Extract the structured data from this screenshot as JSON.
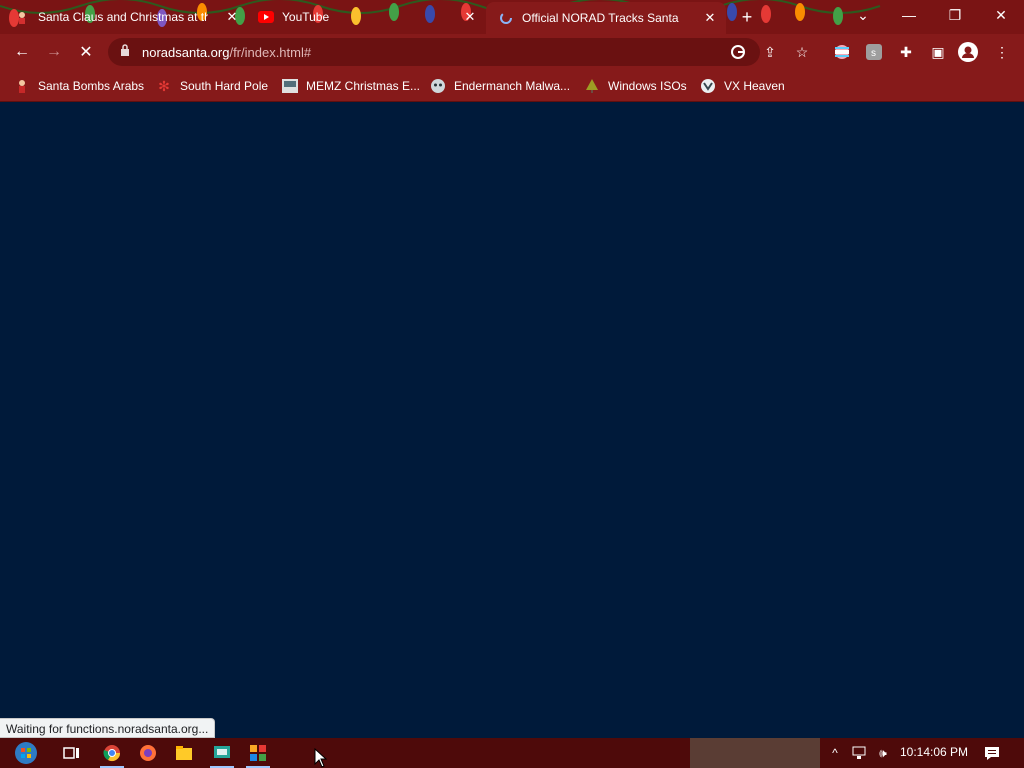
{
  "browser": {
    "tabs": [
      {
        "title": "Santa Claus and Christmas at the",
        "icon": "santa-figure-icon",
        "active": false
      },
      {
        "title": "YouTube",
        "icon": "youtube-icon",
        "active": false
      },
      {
        "title": "Official NORAD Tracks Santa",
        "icon": "loading-spinner-icon",
        "active": true
      }
    ],
    "address": {
      "host": "noradsanta.org",
      "path": "/fr/index.html#"
    },
    "bookmarks": [
      {
        "label": "Santa Bombs Arabs",
        "icon": "santa-figure-icon"
      },
      {
        "label": "South Hard Pole",
        "icon": "snowflake-icon"
      },
      {
        "label": "MEMZ Christmas E...",
        "icon": "memz-icon"
      },
      {
        "label": "Endermanch Malwa...",
        "icon": "enderman-icon"
      },
      {
        "label": "Windows ISOs",
        "icon": "tree-icon"
      },
      {
        "label": "VX Heaven",
        "icon": "vx-heaven-icon"
      }
    ],
    "status_text": "Waiting for functions.noradsanta.org...",
    "colors": {
      "tab_strip": "#7a1414",
      "toolbar": "#861a1a",
      "page_bg": "#001a3a"
    }
  },
  "taskbar": {
    "clock": "10:14:06 PM",
    "apps": [
      "start-orb-icon",
      "task-view-icon",
      "chrome-icon",
      "firefox-icon",
      "file-explorer-icon",
      "tool-icon",
      "control-panel-icon"
    ]
  }
}
